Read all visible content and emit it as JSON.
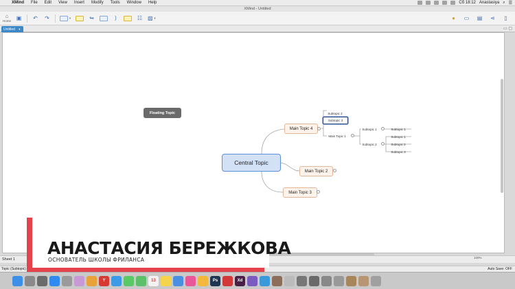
{
  "menubar": {
    "items": [
      "XMind",
      "File",
      "Edit",
      "View",
      "Insert",
      "Modify",
      "Tools",
      "Window",
      "Help"
    ],
    "clock": "Сб 18:12",
    "user": "Anastasiya"
  },
  "window": {
    "title": "XMind - Untitled"
  },
  "toolbar": {
    "home_label": "Home"
  },
  "tabs": [
    {
      "label": "Untitled"
    }
  ],
  "mindmap": {
    "central": "Central Topic",
    "floating": "Floating Topic",
    "main_topics": [
      "Main Topic 4",
      "Main Topic 2",
      "Main Topic 3"
    ],
    "mt4_subtopics": [
      "Subtopic 2",
      "Subtopic 3",
      "Main Topic 1"
    ],
    "mt1_subtopics": [
      "Subtopic 1",
      "Subtopic 2"
    ],
    "leaves": [
      "Subtopic 1",
      "Subtopic 1",
      "Subtopic 2",
      "Subtopic 3"
    ]
  },
  "sheet": {
    "label": "Sheet 1"
  },
  "status": {
    "left": "Topic (Subtopic)",
    "right": "Auto Save: OFF",
    "zoom": "100%"
  },
  "overlay": {
    "name": "АНАСТАСИЯ БЕРЕЖКОВА",
    "role": "ОСНОВАТЕЛЬ ШКОЛЫ ФРИЛАНСА",
    "accent": "#e4434b"
  },
  "dock": {
    "apps": [
      {
        "name": "finder-icon",
        "color": "#3c8ee6",
        "glyph": ""
      },
      {
        "name": "launchpad-icon",
        "color": "#8a8a8a",
        "glyph": ""
      },
      {
        "name": "settings-icon",
        "color": "#6b6b6b",
        "glyph": ""
      },
      {
        "name": "appstore-icon",
        "color": "#2f8bef",
        "glyph": ""
      },
      {
        "name": "trash-icon",
        "color": "#9a9a9a",
        "glyph": ""
      },
      {
        "name": "photos-icon",
        "color": "#c79ad6",
        "glyph": ""
      },
      {
        "name": "chrome-icon",
        "color": "#e8a23a",
        "glyph": ""
      },
      {
        "name": "yandex-icon",
        "color": "#d63a33",
        "glyph": "Y"
      },
      {
        "name": "safari-icon",
        "color": "#3d9ae6",
        "glyph": ""
      },
      {
        "name": "facetime-icon",
        "color": "#5ac864",
        "glyph": ""
      },
      {
        "name": "messages-icon",
        "color": "#5cc06a",
        "glyph": ""
      },
      {
        "name": "calendar-icon",
        "color": "#f2f2f2",
        "glyph": "13"
      },
      {
        "name": "notes-icon",
        "color": "#f5d34b",
        "glyph": ""
      },
      {
        "name": "mail-icon",
        "color": "#4a8fe0",
        "glyph": ""
      },
      {
        "name": "itunes-icon",
        "color": "#e9579a",
        "glyph": ""
      },
      {
        "name": "sketch-icon",
        "color": "#f3b73c",
        "glyph": ""
      },
      {
        "name": "photoshop-icon",
        "color": "#1e3651",
        "glyph": "Ps"
      },
      {
        "name": "xmind-icon",
        "color": "#d23a3a",
        "glyph": ""
      },
      {
        "name": "xd-icon",
        "color": "#4a1f46",
        "glyph": "Xd"
      },
      {
        "name": "viber-icon",
        "color": "#7b5bbf",
        "glyph": ""
      },
      {
        "name": "telegram-icon",
        "color": "#3a9ad9",
        "glyph": ""
      },
      {
        "name": "preview-icon",
        "color": "#8d6e5a",
        "glyph": ""
      },
      {
        "name": "finder-window-icon",
        "color": "#bbbbbb",
        "glyph": ""
      },
      {
        "name": "download-icon",
        "color": "#777777",
        "glyph": ""
      },
      {
        "name": "folder-icon",
        "color": "#6a6a6a",
        "glyph": ""
      },
      {
        "name": "doc-icon",
        "color": "#888888",
        "glyph": ""
      },
      {
        "name": "doc2-icon",
        "color": "#999999",
        "glyph": ""
      },
      {
        "name": "image-icon",
        "color": "#a8865c",
        "glyph": ""
      },
      {
        "name": "image2-icon",
        "color": "#b99673",
        "glyph": ""
      },
      {
        "name": "trash-bin-icon",
        "color": "#a0a0a0",
        "glyph": ""
      }
    ]
  }
}
